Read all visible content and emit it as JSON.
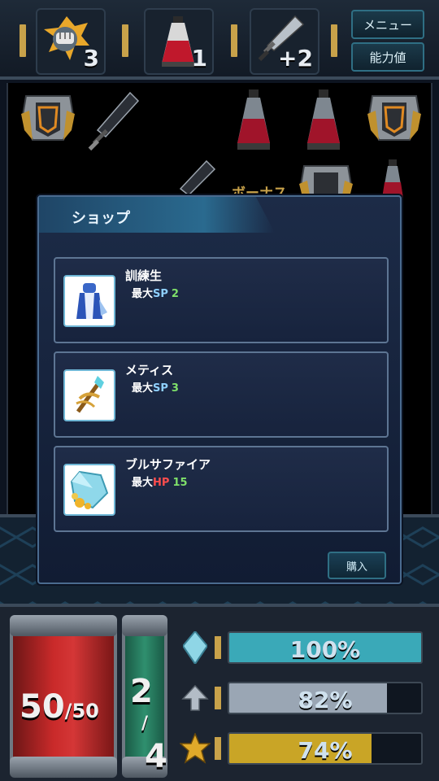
{
  "topbar": {
    "slots": [
      {
        "icon": "fist-icon",
        "count": "3"
      },
      {
        "icon": "potion-icon",
        "count": "1"
      },
      {
        "icon": "sword-icon",
        "count": "+2"
      }
    ],
    "menu_label": "メニュー",
    "ability_label": "能力値"
  },
  "field": {
    "bonus_label": "ボーナス"
  },
  "shop": {
    "title": "ショップ",
    "items": [
      {
        "name": "訓練生",
        "stat_prefix": "最大",
        "stat_key": "SP",
        "stat_value": "2",
        "icon": "trainee-robe-icon"
      },
      {
        "name": "メティス",
        "stat_prefix": "最大",
        "stat_key": "SP",
        "stat_value": "3",
        "icon": "metis-staff-icon"
      },
      {
        "name": "ブルサファイア",
        "stat_prefix": "最大",
        "stat_key": "HP",
        "stat_value": "15",
        "icon": "blue-sapphire-icon"
      }
    ],
    "buy_label": "購入"
  },
  "status": {
    "hp_current": "50",
    "hp_max": "50",
    "sp_current": "2",
    "sp_max": "4",
    "bars": [
      {
        "icon": "crystal-icon",
        "percent_label": "100%",
        "fraction": 1.0,
        "color": "#3aa9b8"
      },
      {
        "icon": "arrow-up-icon",
        "percent_label": "82%",
        "fraction": 0.82,
        "color": "#9aa6b4"
      },
      {
        "icon": "xp-star-icon",
        "percent_label": "74%",
        "fraction": 0.74,
        "color": "#c9a526"
      }
    ]
  },
  "colors": {
    "accent": "#2f6f84",
    "gold": "#c8a24a",
    "hp_red": "#c92a2a",
    "sp_green": "#2f8f6e"
  }
}
